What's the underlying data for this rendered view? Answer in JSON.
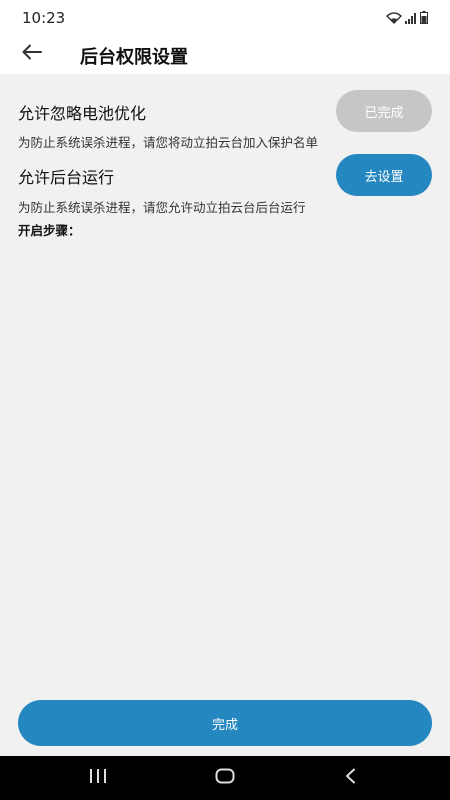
{
  "status_bar": {
    "time": "10:23",
    "icons": [
      "wifi-icon",
      "signal-icon",
      "battery-icon"
    ]
  },
  "app_bar": {
    "back_icon": "arrow-left-icon",
    "title": "后台权限设置"
  },
  "permissions": [
    {
      "title": "允许忽略电池优化",
      "description": "为防止系统误杀进程，请您将动立拍云台加入保护名单",
      "button_label": "已完成",
      "button_color": "#c6c6c6"
    },
    {
      "title": "允许后台运行",
      "description": "为防止系统误杀进程，请您允许动立拍云台后台运行",
      "button_label": "去设置",
      "button_color": "#2487c0"
    }
  ],
  "steps_label": "开启步骤：",
  "finish_button": {
    "label": "完成",
    "color": "#2487c0"
  },
  "nav_bar": {
    "items": [
      "recent-apps-icon",
      "home-icon",
      "back-icon"
    ]
  }
}
